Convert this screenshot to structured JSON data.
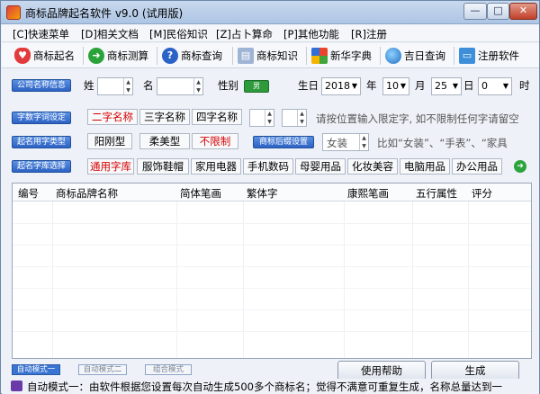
{
  "window": {
    "title": "商标品牌起名软件 v9.0 (试用版)",
    "controls": {
      "minimize": "—",
      "maximize": "□",
      "close": "✕"
    }
  },
  "menu": [
    "[C]快速菜单",
    "[D]相关文档",
    "[M]民俗知识",
    "[Z]占卜算命",
    "[P]其他功能",
    "[R]注册"
  ],
  "toolbar": {
    "items": [
      "商标起名",
      "商标测算",
      "商标查询",
      "商标知识",
      "新华字典",
      "吉日查询",
      "注册软件"
    ]
  },
  "row1": {
    "button": "公司名称信息",
    "surname_label": "姓",
    "name_label": "名",
    "gender_label": "性别",
    "gender_value": "男",
    "birth_label": "生日",
    "year_value": "2018",
    "year_label": "年",
    "month_value": "10",
    "month_label": "月",
    "day_value": "25",
    "day_label": "日",
    "hour_value": "0",
    "hour_label": "时"
  },
  "row2": {
    "button": "字数字词设定",
    "options": [
      "二字名称",
      "三字名称",
      "四字名称"
    ],
    "hint": "请按位置输入限定字, 如不限制任何字请留空"
  },
  "row3": {
    "button": "起名用字类型",
    "options": [
      "阳刚型",
      "柔美型",
      "不限制"
    ],
    "suffix_button": "商标后缀设置",
    "suffix_value": "女装",
    "hint": "比如“女装”、“手表”、“家具"
  },
  "row4": {
    "button": "起名字库选择",
    "categories": [
      "通用字库",
      "服饰鞋帽",
      "家用电器",
      "手机数码",
      "母婴用品",
      "化妆美容",
      "电脑用品",
      "办公用品"
    ]
  },
  "table": {
    "columns": [
      "编号",
      "商标品牌名称",
      "简体笔画",
      "繁体字",
      "康熙笔画",
      "五行属性",
      "评分"
    ]
  },
  "bottom": {
    "mode_tabs": [
      "自动模式一",
      "自动模式二",
      "组合模式"
    ],
    "help_button": "使用帮助",
    "generate_button": "生成"
  },
  "status": {
    "text": "自动模式一：由软件根据您设置每次自动生成500多个商标名；觉得不满意可重复生成，名称总量达到一"
  },
  "colors": {
    "accent_blue": "#2c62c4",
    "highlight_red": "#d40000",
    "toggle_green": "#2e9a3c"
  }
}
